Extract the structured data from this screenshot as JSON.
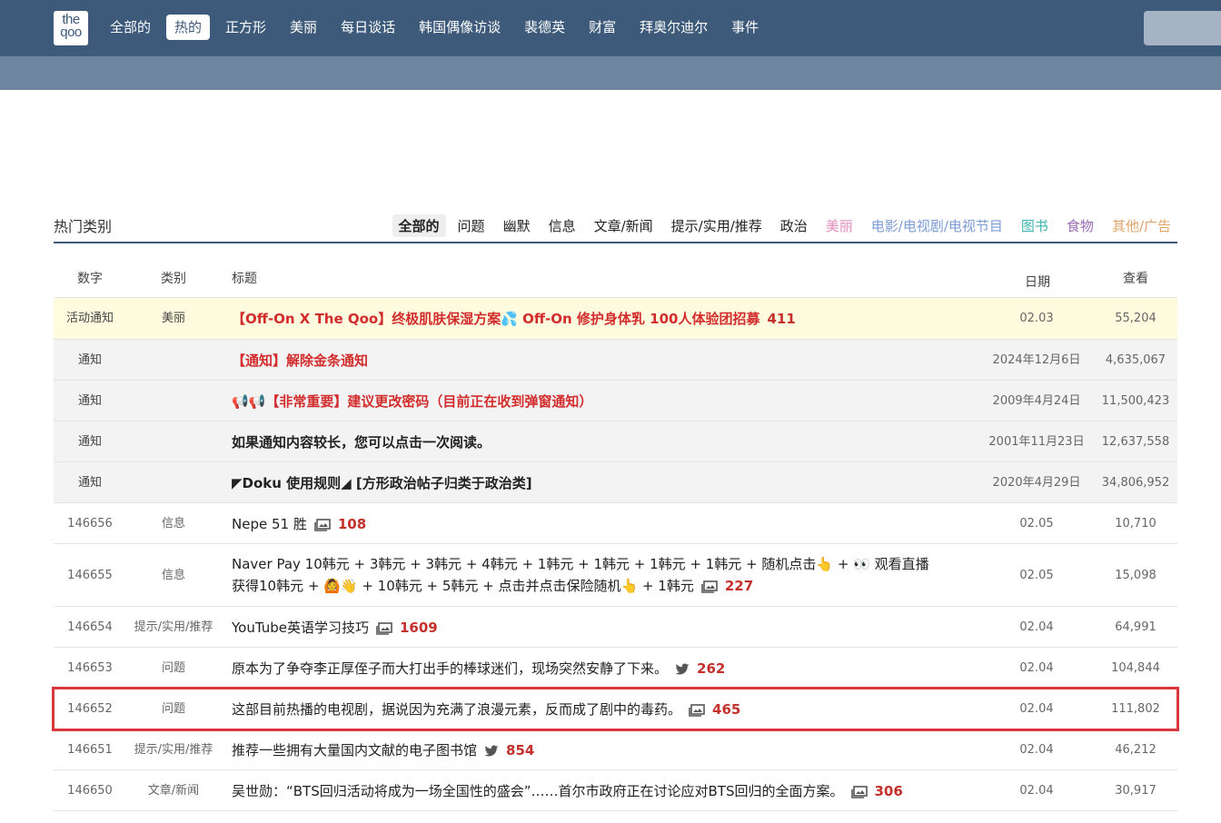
{
  "header": {
    "logo_text": "the qoo",
    "nav": [
      "全部的",
      "热的",
      "正方形",
      "美丽",
      "每日谈话",
      "韩国偶像访谈",
      "裴德英",
      "财富",
      "拜奥尔迪尔",
      "事件"
    ],
    "nav_active_index": 1
  },
  "category_bar": {
    "title": "热门类别",
    "tabs": [
      {
        "label": "全部的",
        "color": "#222222"
      },
      {
        "label": "问题",
        "color": "#222222"
      },
      {
        "label": "幽默",
        "color": "#222222"
      },
      {
        "label": "信息",
        "color": "#222222"
      },
      {
        "label": "文章/新闻",
        "color": "#222222"
      },
      {
        "label": "提示/实用/推荐",
        "color": "#222222"
      },
      {
        "label": "政治",
        "color": "#222222"
      },
      {
        "label": "美丽",
        "color": "#e38bbd"
      },
      {
        "label": "电影/电视剧/电视节目",
        "color": "#7c9cd4"
      },
      {
        "label": "图书",
        "color": "#3fb5b0"
      },
      {
        "label": "食物",
        "color": "#9a6cb4"
      },
      {
        "label": "其他/广告",
        "color": "#e0a46a"
      }
    ],
    "active_index": 0
  },
  "table": {
    "headers": {
      "num": "数字",
      "category": "类别",
      "title": "标题",
      "date": "日期",
      "views": "查看"
    },
    "event_row": {
      "num": "活动通知",
      "category": "美丽",
      "title": "【Off-On X The Qoo】终极肌肤保湿方案💦 Off-On 修护身体乳 100人体验团招募",
      "comments": "411",
      "date": "02.03",
      "views": "55,204"
    },
    "notices": [
      {
        "num": "通知",
        "title": "【通知】解除金条通知",
        "style": "red",
        "date": "2024年12月6日",
        "views": "4,635,067"
      },
      {
        "num": "通知",
        "title": "📢📢【非常重要】建议更改密码（目前正在收到弹窗通知）",
        "style": "red",
        "date": "2009年4月24日",
        "views": "11,500,423"
      },
      {
        "num": "通知",
        "title": "如果通知内容较长，您可以点击一次阅读。",
        "style": "bold",
        "date": "2001年11月23日",
        "views": "12,637,558"
      },
      {
        "num": "通知",
        "title": "◤Doku 使用规则◢ [方形政治帖子归类于政治类]",
        "style": "bold",
        "date": "2020年4月29日",
        "views": "34,806,952"
      }
    ],
    "posts": [
      {
        "num": "146656",
        "category": "信息",
        "title_lines": [
          "Nepe 51 胜"
        ],
        "icon": "image-icon",
        "comments": "108",
        "date": "02.05",
        "views": "10,710"
      },
      {
        "num": "146655",
        "category": "信息",
        "title_lines": [
          "Naver Pay 10韩元 + 3韩元 + 3韩元 + 4韩元 + 1韩元 + 1韩元 + 1韩元 + 1韩元 + 随机点击👆 + 👀 观看直播",
          "获得10韩元 + 🙆👋 + 10韩元 + 5韩元 + 点击并点击保险随机👆 + 1韩元"
        ],
        "icon": "image-icon",
        "comments": "227",
        "date": "02.05",
        "views": "15,098"
      },
      {
        "num": "146654",
        "category": "提示/实用/推荐",
        "title_lines": [
          "YouTube英语学习技巧"
        ],
        "icon": "image-icon",
        "comments": "1609",
        "date": "02.04",
        "views": "64,991"
      },
      {
        "num": "146653",
        "category": "问题",
        "title_lines": [
          "原本为了争夺李正厚侄子而大打出手的棒球迷们，现场突然安静了下来。"
        ],
        "icon": "twitter-icon",
        "comments": "262",
        "date": "02.04",
        "views": "104,844"
      },
      {
        "num": "146652",
        "category": "问题",
        "title_lines": [
          "这部目前热播的电视剧，据说因为充满了浪漫元素，反而成了剧中的毒药。"
        ],
        "icon": "image-icon",
        "comments": "465",
        "date": "02.04",
        "views": "111,802",
        "selected": true
      },
      {
        "num": "146651",
        "category": "提示/实用/推荐",
        "title_lines": [
          "推荐一些拥有大量国内文献的电子图书馆"
        ],
        "icon": "twitter-icon",
        "comments": "854",
        "date": "02.04",
        "views": "46,212"
      },
      {
        "num": "146650",
        "category": "文章/新闻",
        "title_lines": [
          "吴世勋：“BTS回归活动将成为一场全国性的盛会”……首尔市政府正在讨论应对BTS回归的全面方案。"
        ],
        "icon": "image-icon",
        "comments": "306",
        "date": "02.04",
        "views": "30,917"
      }
    ]
  }
}
